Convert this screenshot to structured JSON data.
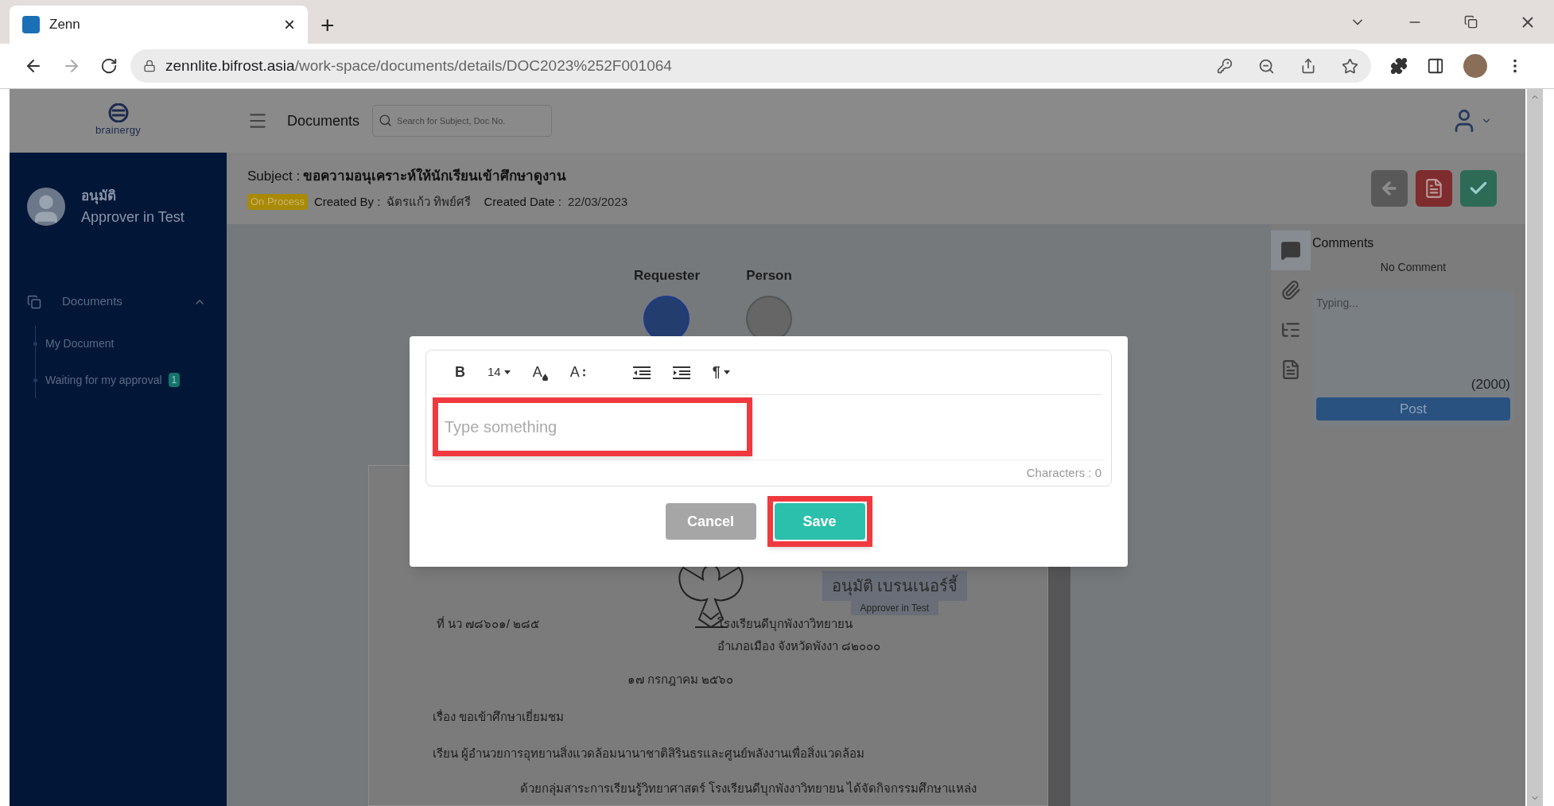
{
  "browser": {
    "tab": {
      "title": "Zenn",
      "close": "×"
    },
    "new_tab": "+",
    "url": {
      "host": "zennlite.bifrost.asia",
      "path": "/work-space/documents/details/DOC2023%252F001064"
    }
  },
  "app": {
    "logo_text": "brainergy",
    "header_title": "Documents",
    "search": {
      "placeholder": "Search for Subject, Doc No."
    }
  },
  "user": {
    "name": "อนุมัติ",
    "role": "Approver in Test"
  },
  "sidebar": {
    "section": {
      "label": "Documents",
      "expanded": true,
      "children": [
        {
          "label": "My Document",
          "selected": false
        },
        {
          "label": "Waiting for my approval",
          "badge": "1",
          "selected": false
        }
      ]
    }
  },
  "document": {
    "subject_label": "Subject :",
    "subject": "ขอความอนุเคราะห์ให้นักเรียนเข้าศึกษาดูงาน",
    "status": "On Process",
    "created_by_label": "Created By :",
    "created_by": "ฉัตรแก้ว ทิพย์ศรี",
    "created_date_label": "Created Date :",
    "created_date": "22/03/2023"
  },
  "workflow": [
    {
      "label": "Requester",
      "done": true
    },
    {
      "label": "Person",
      "done": false
    }
  ],
  "actions": [
    {
      "kind": "back"
    },
    {
      "kind": "reject"
    },
    {
      "kind": "approve"
    }
  ],
  "side_tabs": [
    {
      "kind": "comments",
      "selected": true
    },
    {
      "kind": "attachments",
      "selected": false
    },
    {
      "kind": "timeline",
      "selected": false
    },
    {
      "kind": "document",
      "selected": false
    }
  ],
  "comments": {
    "title": "Comments",
    "empty": "No Comment",
    "input": {
      "placeholder": "Typing..."
    },
    "limit": "(2000)",
    "post": "Post"
  },
  "letter": {
    "stamp": {
      "name": "อนุมัติ เบรนเนอร์จี้",
      "role": "Approver in Test"
    },
    "ref": "ที่ นว ๗๘๖๐๑/ ๒๘๕",
    "address": [
      "โรงเรียนดีบุกพังงาวิทยายน",
      "อำเภอเมือง จังหวัดพังงา ๘๒๐๐๐"
    ],
    "date": "๑๗ กรกฎาคม ๒๕๖๐",
    "lines": [
      "เรื่อง  ขอเข้าศึกษาเยี่ยมชม",
      "เรียน  ผู้อำนวยการอุทยานสิ่งแวดล้อมนานาชาติสิรินธรและศูนย์พลังงานเพื่อสิ่งแวดล้อม"
    ],
    "paragraph": "ด้วยกลุ่มสาระการเรียนรู้วิทยาศาสตร์ โรงเรียนดีบุกพังงาวิทยายน ได้จัดกิจกรรมศึกษาแหล่ง"
  },
  "modal": {
    "toolbar": [
      {
        "kind": "bold",
        "label": "B"
      },
      {
        "kind": "size",
        "label": "14"
      },
      {
        "kind": "color",
        "label": "A"
      },
      {
        "kind": "font-size",
        "label": "A"
      },
      {
        "kind": "outdent"
      },
      {
        "kind": "indent"
      },
      {
        "kind": "paragraph",
        "label": "¶"
      }
    ],
    "editor": {
      "placeholder": "Type something",
      "highlighted": true
    },
    "counter": "Characters : 0",
    "buttons": [
      {
        "kind": "cancel",
        "label": "Cancel",
        "highlighted": false
      },
      {
        "kind": "save",
        "label": "Save",
        "highlighted": true
      }
    ]
  }
}
